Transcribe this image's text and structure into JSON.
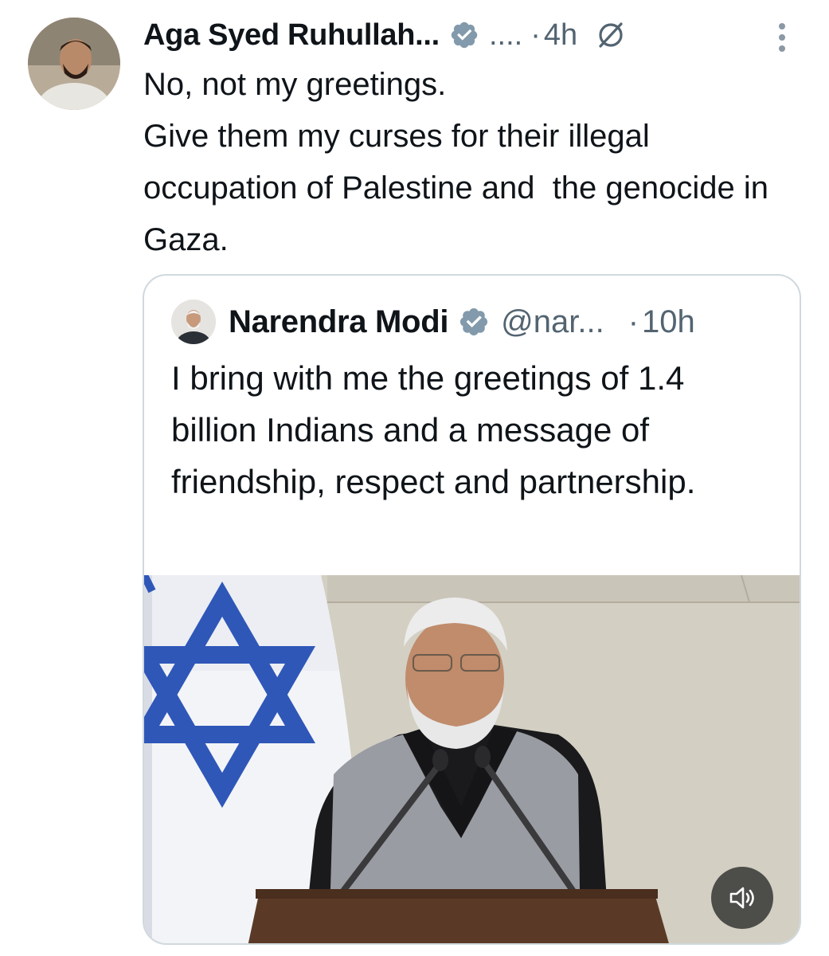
{
  "tweet": {
    "author_name": "Aga Syed Ruhullah...",
    "handle": "....",
    "separator": "·",
    "time": "4h",
    "text_lines": [
      "No, not my greetings.",
      "Give them my curses for their illegal occupation of Palestine and  the genocide in Gaza."
    ],
    "icons": {
      "avatar": "avatar",
      "verified": "verified-badge-icon",
      "grok": "grok-icon",
      "more": "more-options-icon"
    }
  },
  "quoted_tweet": {
    "author_name": "Narendra Modi",
    "handle": "@nar...",
    "separator": "·",
    "time": "10h",
    "text": "I bring with me the greetings of 1.4 billion Indians and a message of friendship, respect and partnership.",
    "media": {
      "type": "video",
      "volume_icon": "volume-icon"
    }
  },
  "colors": {
    "text_primary": "#0f1419",
    "text_secondary": "#536471",
    "verified_badge": "#829aab",
    "border": "#cfd9de",
    "flag_blue": "#2f57b8"
  }
}
